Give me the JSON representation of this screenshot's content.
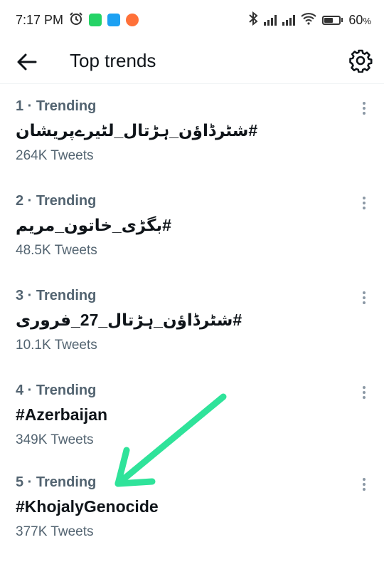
{
  "status_bar": {
    "time": "7:17 PM",
    "battery": "60",
    "battery_unit": "%",
    "battery_level": 0.6
  },
  "header": {
    "title": "Top trends"
  },
  "trends": [
    {
      "meta": "1 · Trending",
      "name": "#شٹرڈاؤن_ہڑتال_لٹیرےپریشان",
      "count": "264K Tweets"
    },
    {
      "meta": "2 · Trending",
      "name": "#بگڑی_خاتون_مریم",
      "count": "48.5K Tweets"
    },
    {
      "meta": "3 · Trending",
      "name": "#شٹرڈاؤن_ہڑتال_27_فروری",
      "count": "10.1K Tweets"
    },
    {
      "meta": "4 · Trending",
      "name": "#Azerbaijan",
      "count": "349K Tweets"
    },
    {
      "meta": "5 · Trending",
      "name": "#KhojalyGenocide",
      "count": "377K Tweets"
    }
  ],
  "colors": {
    "annotation_arrow": "#2fe39a",
    "secondary_text": "#536471",
    "primary_text": "#0f1419"
  }
}
